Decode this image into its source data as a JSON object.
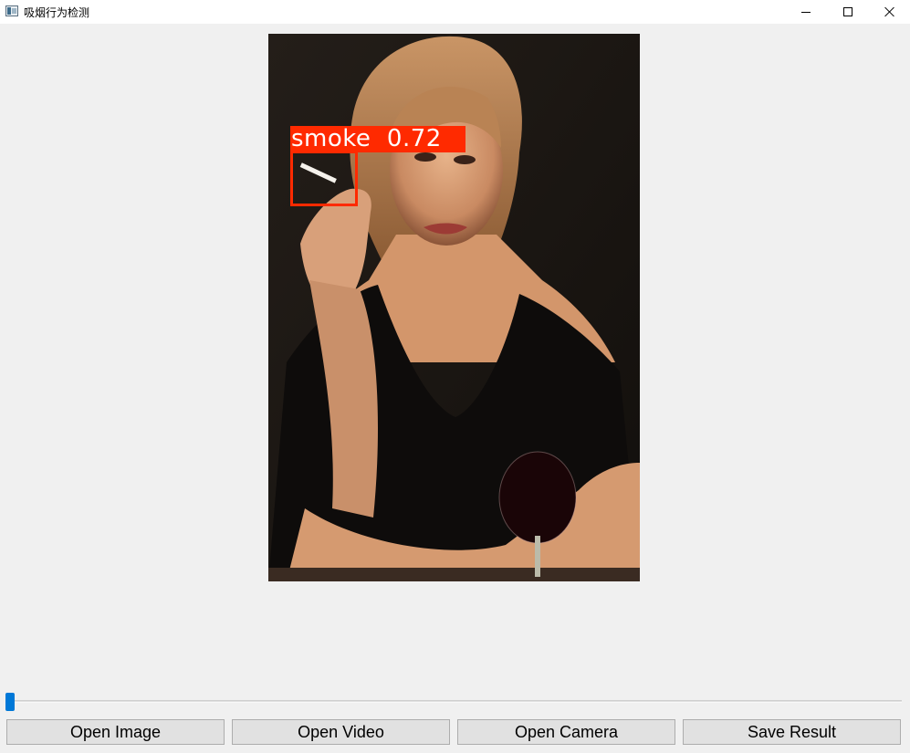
{
  "window": {
    "title": "吸烟行为检测",
    "icon": "app-window-icon",
    "controls": [
      "minimize-icon",
      "maximize-icon",
      "close-icon"
    ]
  },
  "detection": {
    "label": "smoke  0.72",
    "color": "#ff2a00"
  },
  "slider": {
    "value": 0,
    "accent": "#0078d7"
  },
  "buttons": {
    "open_image": "Open Image",
    "open_video": "Open Video",
    "open_camera": "Open Camera",
    "save_result": "Save Result"
  }
}
